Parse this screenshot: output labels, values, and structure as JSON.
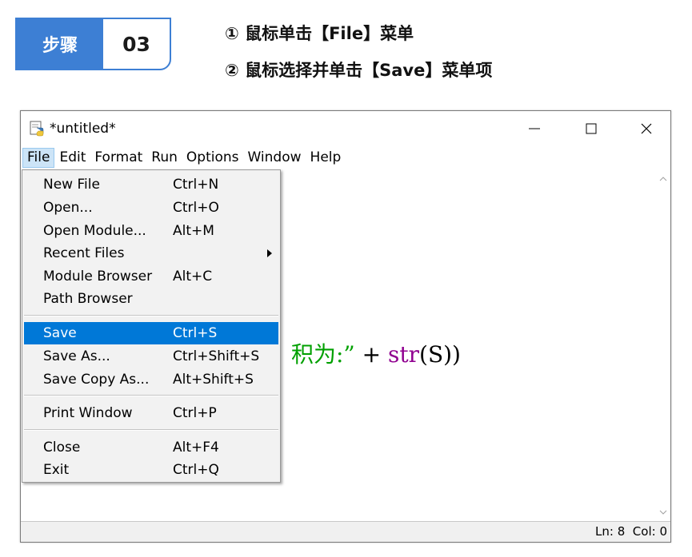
{
  "step": {
    "label": "步骤",
    "number": "03",
    "instructions": [
      "① 鼠标单击【File】菜单",
      "② 鼠标选择并单击【Save】菜单项"
    ]
  },
  "window": {
    "title": "*untitled*",
    "app_icon": "python-idle-icon",
    "controls": [
      "minimize-icon",
      "maximize-icon",
      "close-icon"
    ]
  },
  "menubar": [
    "File",
    "Edit",
    "Format",
    "Run",
    "Options",
    "Window",
    "Help"
  ],
  "active_menu": "File",
  "file_menu": {
    "groups": [
      [
        {
          "label": "New File",
          "accel": "Ctrl+N"
        },
        {
          "label": "Open...",
          "accel": "Ctrl+O"
        },
        {
          "label": "Open Module...",
          "accel": "Alt+M"
        },
        {
          "label": "Recent Files",
          "accel": "",
          "submenu": true
        },
        {
          "label": "Module Browser",
          "accel": "Alt+C"
        },
        {
          "label": "Path Browser",
          "accel": ""
        }
      ],
      [
        {
          "label": "Save",
          "accel": "Ctrl+S",
          "selected": true
        },
        {
          "label": "Save As...",
          "accel": "Ctrl+Shift+S"
        },
        {
          "label": "Save Copy As...",
          "accel": "Alt+Shift+S"
        }
      ],
      [
        {
          "label": "Print Window",
          "accel": "Ctrl+P"
        }
      ],
      [
        {
          "label": "Close",
          "accel": "Alt+F4"
        },
        {
          "label": "Exit",
          "accel": "Ctrl+Q"
        }
      ]
    ]
  },
  "editor": {
    "visible_code": {
      "part_green": "积为:”",
      "part_plain1": " + ",
      "part_purple": "str",
      "part_plain2": "(S))"
    }
  },
  "status": {
    "text": "Ln: 8  Col: 0"
  },
  "colors": {
    "step_blue": "#3d7fd4",
    "menu_highlight": "#0078d7",
    "string_green": "#00a000",
    "builtin_purple": "#900090"
  }
}
